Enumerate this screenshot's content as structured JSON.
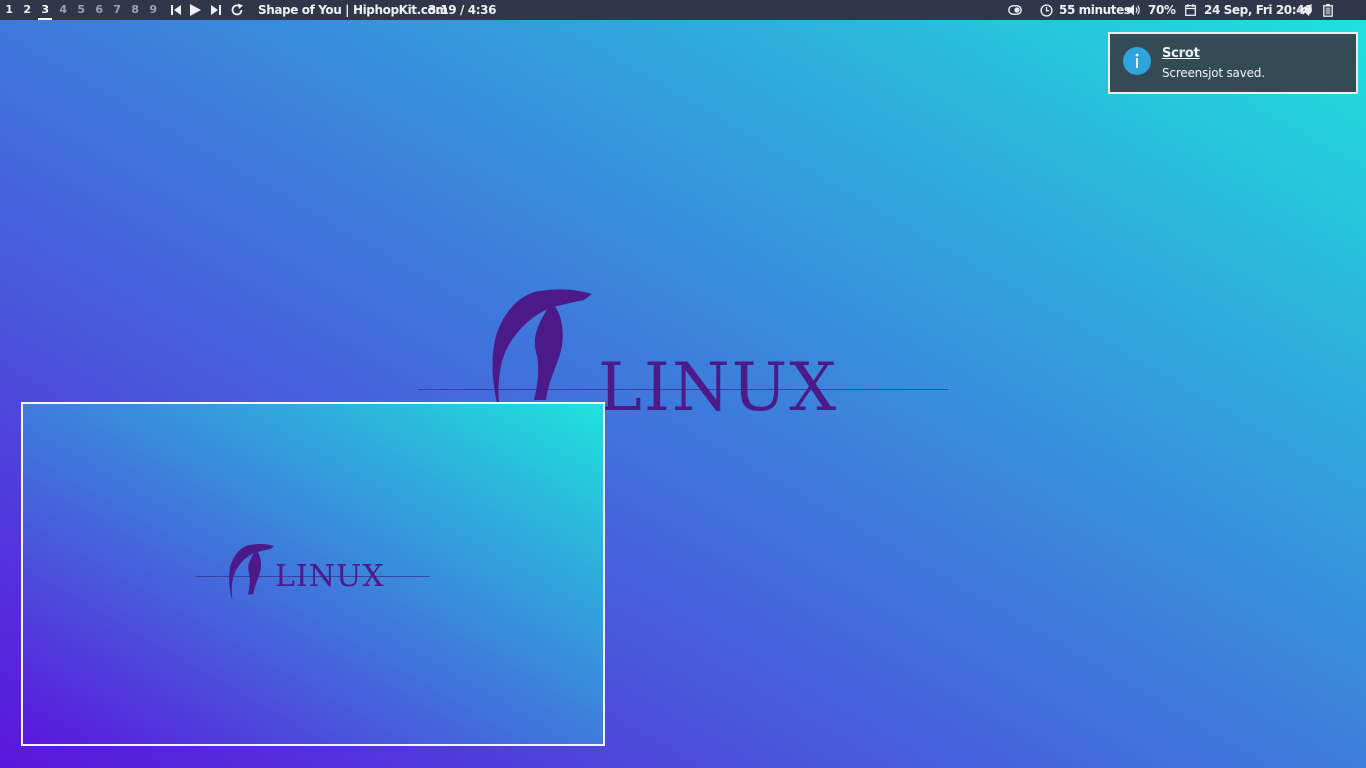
{
  "topbar": {
    "workspaces": [
      {
        "label": "1",
        "state": "occupied"
      },
      {
        "label": "2",
        "state": "occupied"
      },
      {
        "label": "3",
        "state": "active"
      },
      {
        "label": "4",
        "state": "empty"
      },
      {
        "label": "5",
        "state": "empty"
      },
      {
        "label": "6",
        "state": "empty"
      },
      {
        "label": "7",
        "state": "empty"
      },
      {
        "label": "8",
        "state": "empty"
      },
      {
        "label": "9",
        "state": "empty"
      }
    ],
    "media": {
      "track": "Shape of You | HiphopKit.com",
      "time": "3:19 / 4:36"
    },
    "status": {
      "timer": "55 minutes",
      "volume": "70%",
      "datetime": "24 Sep, Fri 20:40"
    },
    "icons": [
      "skip-previous-icon",
      "play-icon",
      "skip-next-icon",
      "repeat-icon",
      "toggle-icon",
      "clock-icon",
      "volume-icon",
      "calendar-icon",
      "telegram-icon",
      "battery-icon"
    ]
  },
  "wallpaper": {
    "logo_text": "LINUX"
  },
  "notification": {
    "app": "Scrot",
    "message": "Screensjot saved.",
    "icon": "info-icon"
  },
  "colors": {
    "bar": "#31364a",
    "gradient_start": "#5a16dc",
    "gradient_end": "#1ee3db",
    "logo": "#4d1a8a",
    "notification_bg": "#344a55",
    "info_icon": "#2fa3dc"
  }
}
